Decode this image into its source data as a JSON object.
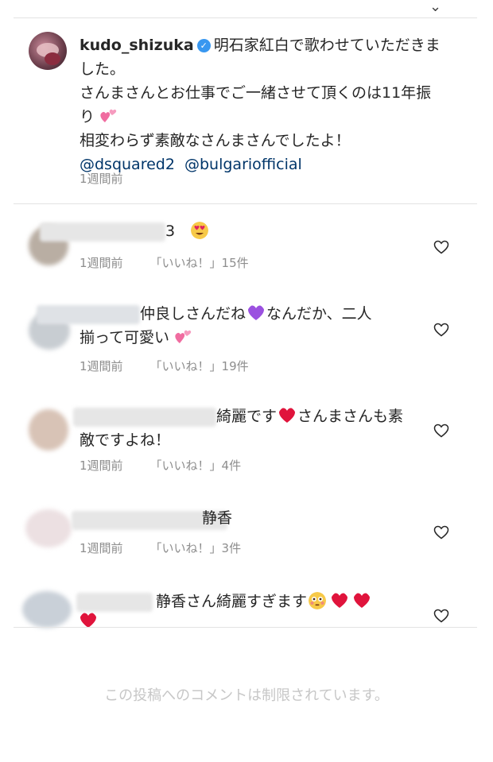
{
  "post": {
    "username": "kudo_shizuka",
    "caption_line1": "明石家紅白で歌わせていただきま",
    "caption_line2": "した。",
    "caption_line3": "さんまさんとお仕事でご一緒させて頂くのは11年振",
    "caption_line4": "り",
    "caption_line5": "相変わらず素敵なさんまさんでしたよ！",
    "mention1": "@dsquared2",
    "mention2": "@bulgariofficial",
    "time": "1週間前"
  },
  "comments": [
    {
      "text1": "3",
      "time": "1週間前",
      "likes": "「いいね！」15件"
    },
    {
      "text1": "仲良しさんだね",
      "text1b": "なんだか、二人",
      "text2": "揃って可愛い",
      "time": "1週間前",
      "likes": "「いいね！」19件"
    },
    {
      "text1": "綺麗です",
      "text1b": "さんまさんも素",
      "text2": "敵ですよね！",
      "time": "1週間前",
      "likes": "「いいね！」4件"
    },
    {
      "text1": "静香",
      "time": "1週間前",
      "likes": "「いいね！」3件"
    },
    {
      "text1": "静香さん綺麗すぎます"
    }
  ],
  "footer": {
    "restricted_text": "この投稿へのコメントは制限されています。"
  },
  "icons": {
    "verified": "verified-badge-icon",
    "like": "heart-outline-icon"
  }
}
